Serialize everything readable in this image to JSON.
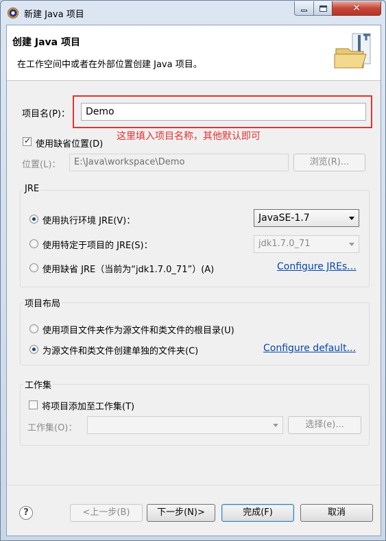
{
  "window": {
    "title": "新建 Java 项目"
  },
  "header": {
    "title": "创建 Java 项目",
    "description": "在工作空间中或者在外部位置创建 Java 项目。"
  },
  "project_name": {
    "label": "项目名(P)：",
    "value": "Demo"
  },
  "annotation": {
    "text": "这里填入项目名称，其他默认即可"
  },
  "default_location": {
    "label": "使用缺省位置(D)",
    "checked": true
  },
  "location": {
    "label": "位置(L)：",
    "value": "E:\\Java\\workspace\\Demo",
    "browse_label": "浏览(R)..."
  },
  "jre": {
    "legend": "JRE",
    "option_env_label": "使用执行环境 JRE(V)：",
    "env_value": "JavaSE-1.7",
    "option_project_label": "使用特定于项目的 JRE(S)：",
    "project_value": "jdk1.7.0_71",
    "option_default_label": "使用缺省 JRE（当前为“jdk1.7.0_71”）(A)",
    "configure_link": "Configure JREs..."
  },
  "layout": {
    "legend": "项目布局",
    "option_root_label": "使用项目文件夹作为源文件和类文件的根目录(U)",
    "option_separate_label": "为源文件和类文件创建单独的文件夹(C)",
    "configure_link": "Configure default..."
  },
  "working_set": {
    "legend": "工作集",
    "add_label": "将项目添加至工作集(T)",
    "set_label": "工作集(O)：",
    "select_label": "选择(e)..."
  },
  "footer": {
    "help_glyph": "?",
    "back_label": "<上一步(B)",
    "next_label": "下一步(N)>",
    "finish_label": "完成(F)",
    "cancel_label": "取消"
  },
  "colors": {
    "annotation_red": "#e23232",
    "link_blue": "#0645ad"
  }
}
